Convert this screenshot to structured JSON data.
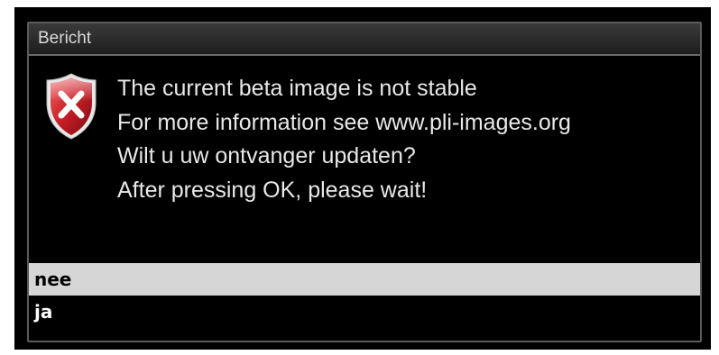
{
  "dialog": {
    "title": "Bericht",
    "icon": "error-shield-icon",
    "message_lines": [
      "The current beta image is not stable",
      "For more information see www.pli-images.org",
      "Wilt u uw ontvanger updaten?",
      "After pressing OK, please wait!"
    ],
    "choices": [
      {
        "label": "nee",
        "selected": true
      },
      {
        "label": "ja",
        "selected": false
      }
    ]
  },
  "colors": {
    "background": "#000000",
    "selection": "#d6d6d6",
    "icon_red": "#c0202a"
  }
}
